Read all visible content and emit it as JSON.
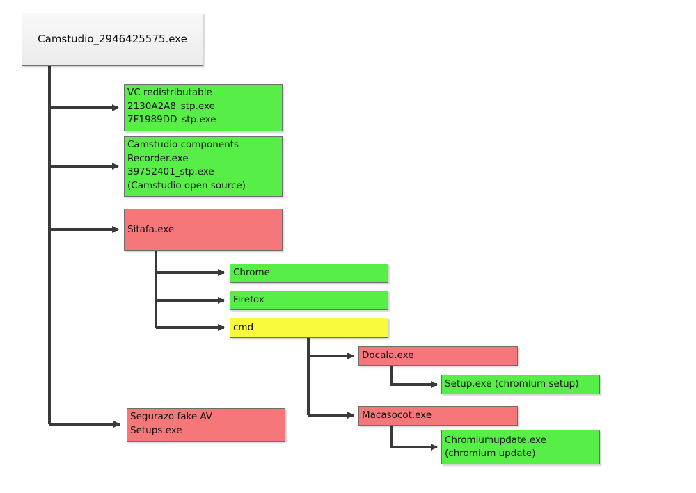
{
  "diagram": {
    "type": "process tree",
    "colors": {
      "benign": "#58ee48",
      "malicious": "#f6777a",
      "shell": "#fafa3c",
      "root": "#eeeeee",
      "connector": "#3a3a3a"
    },
    "root": {
      "id": "root",
      "lines": [
        "Camstudio_2946425575.exe"
      ]
    },
    "nodes": [
      {
        "id": "vc",
        "parent": "root",
        "kind": "benign",
        "title": "VC redistributable",
        "lines": [
          "2130A2A8_stp.exe",
          "7F1989DD_stp.exe"
        ]
      },
      {
        "id": "camcomp",
        "parent": "root",
        "kind": "benign",
        "title": "Camstudio components",
        "lines": [
          "Recorder.exe",
          "39752401_stp.exe",
          "(Camstudio open source)"
        ]
      },
      {
        "id": "sitafa",
        "parent": "root",
        "kind": "malicious",
        "title": "",
        "lines": [
          "Sitafa.exe"
        ]
      },
      {
        "id": "chrome",
        "parent": "sitafa",
        "kind": "benign",
        "title": "",
        "lines": [
          "Chrome"
        ]
      },
      {
        "id": "firefox",
        "parent": "sitafa",
        "kind": "benign",
        "title": "",
        "lines": [
          "Firefox"
        ]
      },
      {
        "id": "cmd",
        "parent": "sitafa",
        "kind": "shell",
        "title": "",
        "lines": [
          "cmd"
        ]
      },
      {
        "id": "docala",
        "parent": "cmd",
        "kind": "malicious",
        "title": "",
        "lines": [
          "Docala.exe"
        ]
      },
      {
        "id": "setup",
        "parent": "docala",
        "kind": "benign",
        "title": "",
        "lines": [
          "Setup.exe (chromium setup)"
        ]
      },
      {
        "id": "macasocot",
        "parent": "cmd",
        "kind": "malicious",
        "title": "",
        "lines": [
          "Macasocot.exe"
        ]
      },
      {
        "id": "chromiumupdate",
        "parent": "macasocot",
        "kind": "benign",
        "title": "",
        "lines": [
          "Chromiumupdate.exe",
          "(chromium update)"
        ]
      },
      {
        "id": "segurazo",
        "parent": "root",
        "kind": "malicious",
        "title": "Segurazo fake AV",
        "lines": [
          "Setups.exe"
        ]
      }
    ]
  }
}
